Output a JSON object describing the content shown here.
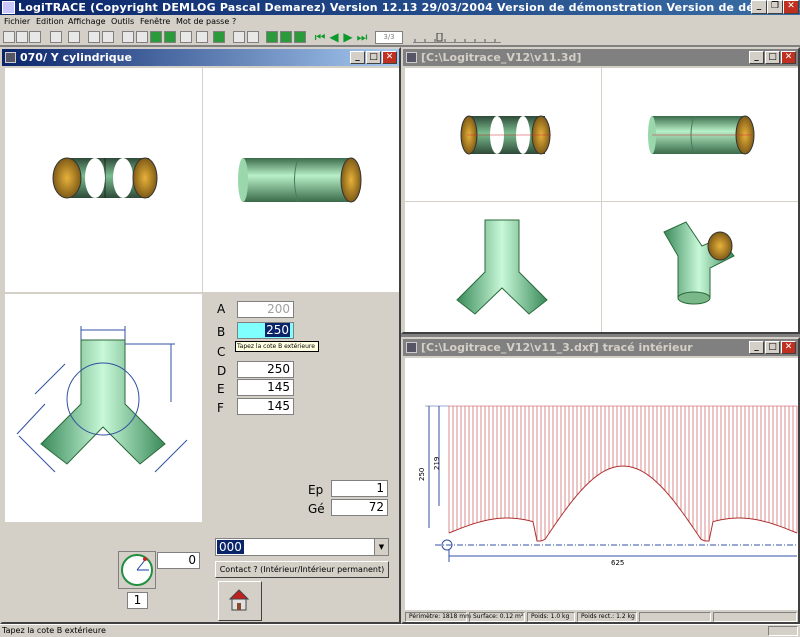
{
  "app": {
    "title": "LogiTRACE  (Copyright DEMLOG Pascal Demarez)  Version 12.13 29/03/2004  Version de démonstration  Version de démonstration"
  },
  "menu": [
    "Fichier",
    "Edition",
    "Affichage",
    "Outils",
    "Fenêtre",
    "Mot de passe",
    "?"
  ],
  "toolbar": {
    "page_indicator": "3/3"
  },
  "window_left": {
    "title": "070/ Y cylindrique",
    "fields": [
      {
        "label": "A",
        "value": "200"
      },
      {
        "label": "B",
        "value": "250"
      },
      {
        "label": "C",
        "value": ""
      },
      {
        "label": "D",
        "value": "250"
      },
      {
        "label": "E",
        "value": "145"
      },
      {
        "label": "F",
        "value": "145"
      }
    ],
    "tooltip": "Tapez la cote B extérieure",
    "ep_label": "Ep",
    "ep_value": "1",
    "ge_label": "Gé",
    "ge_value": "72",
    "combo_value": "000",
    "contact_button": "Contact ? (Intérieur/Intérieur permanent)",
    "angle_value": "0",
    "counter_value": "1"
  },
  "window_3d": {
    "title": "[C:\\Logitrace_V12\\v11.3d]"
  },
  "window_dxf": {
    "title": "[C:\\Logitrace_V12\\v11_3.dxf]  tracé intérieur",
    "dim_250": "250",
    "dim_219": "219",
    "dim_625": "625",
    "status": [
      "Périmètre: 1818 mm",
      "Surface: 0.12 m²",
      "Poids: 1.0 kg",
      "Poids rect.: 1.2 kg"
    ]
  },
  "statusbar": {
    "text": "Tapez la cote B extérieure"
  }
}
